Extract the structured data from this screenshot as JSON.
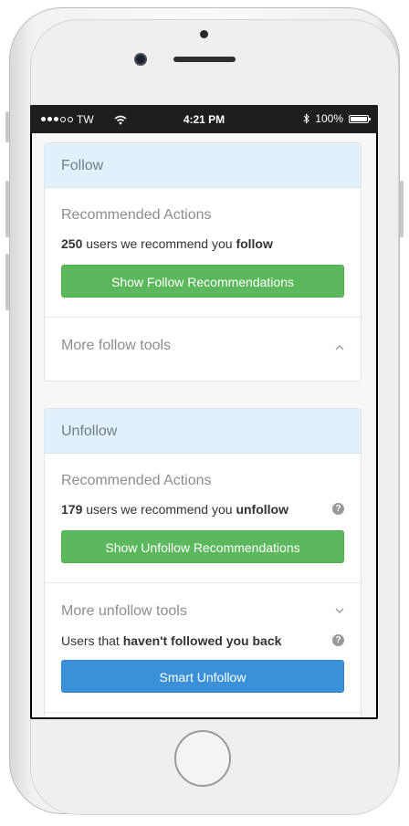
{
  "status_bar": {
    "carrier": "TW",
    "time": "4:21 PM",
    "battery": "100%"
  },
  "follow_panel": {
    "title": "Follow",
    "section_title": "Recommended Actions",
    "count": "250",
    "text": "users we recommend you",
    "action_word": "follow",
    "button_label": "Show Follow Recommendations",
    "more_tools_label": "More follow tools"
  },
  "unfollow_panel": {
    "title": "Unfollow",
    "section_title": "Recommended Actions",
    "count": "179",
    "text": "users we recommend you",
    "action_word": "unfollow",
    "button_label": "Show Unfollow Recommendations",
    "more_tools_label": "More unfollow tools",
    "not_following_prefix": "Users that",
    "not_following_bold": "haven't followed you back",
    "smart_unfollow_label": "Smart Unfollow"
  },
  "icons": {
    "help": "question-circle-icon",
    "chevron_up": "chevron-up-icon",
    "chevron_down": "chevron-down-icon",
    "wifi": "wifi-icon",
    "bluetooth": "bluetooth-icon"
  },
  "colors": {
    "green_button": "#5cb85c",
    "blue_button": "#3a91d8",
    "panel_header": "#e1f0fb"
  }
}
